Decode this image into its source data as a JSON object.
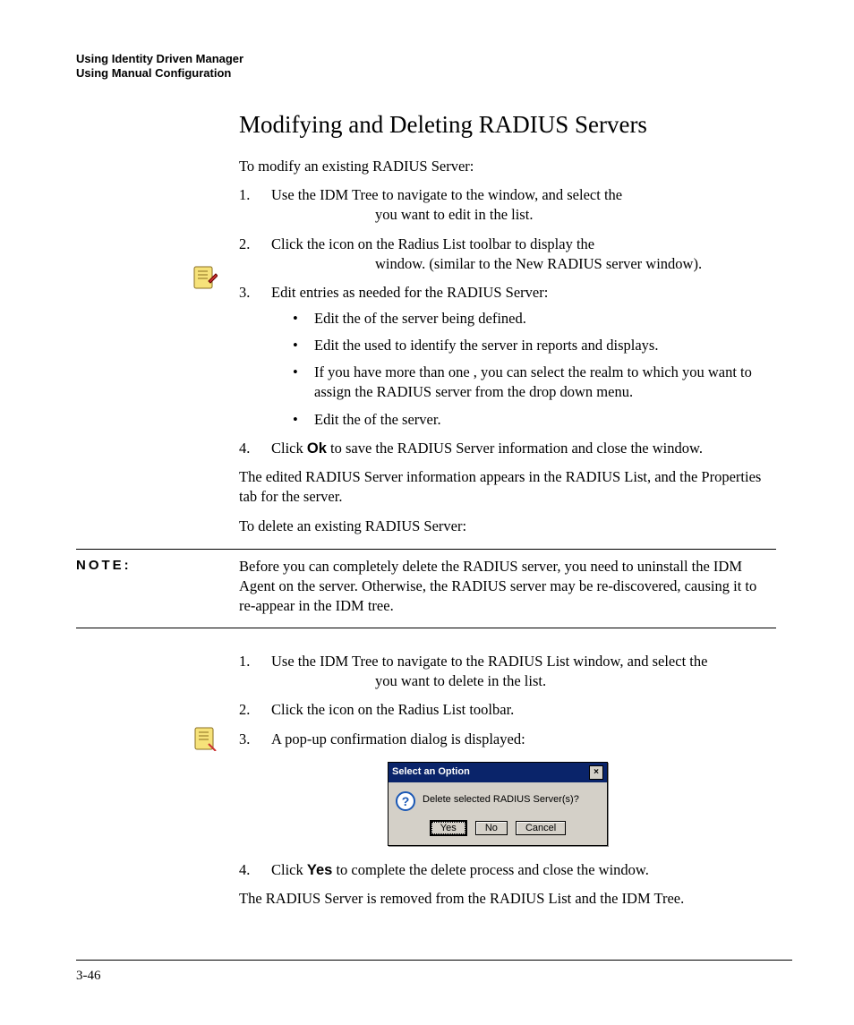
{
  "header": {
    "line1": "Using Identity Driven Manager",
    "line2": "Using Manual Configuration"
  },
  "section_title": "Modifying and Deleting RADIUS Servers",
  "modify_intro": "To modify an existing RADIUS Server:",
  "modify_steps": {
    "s1a": "Use the IDM Tree to navigate to the ",
    "s1b": " window, and select the ",
    "s1c": " you want to edit in the list.",
    "s1_blank1": "",
    "s1_blank2": "",
    "s2a": "Click the ",
    "s2b": " icon on the Radius List toolbar to display the ",
    "s2c": " window. (similar to the New RADIUS server window).",
    "s3": "Edit entries as needed for the RADIUS Server:",
    "b1a": "Edit the ",
    "b1b": " of the server being defined.",
    "b2a": "Edit the ",
    "b2b": " used to identify the server in reports and displays.",
    "b3a": "If you have more than one ",
    "b3b": ", you can select the realm to which you want to assign the RADIUS server from the drop down menu.",
    "b4a": "Edit the ",
    "b4b": " of the server.",
    "s4a": "Click ",
    "s4_ok": "Ok",
    "s4b": " to save the RADIUS Server information and close the window."
  },
  "modify_after": "The edited RADIUS Server information appears in the RADIUS List, and the Properties tab for the server.",
  "delete_intro": "To delete an existing RADIUS Server:",
  "note": {
    "label": "NOTE:",
    "text": "Before you can completely delete the RADIUS server, you need to uninstall the IDM Agent on the server. Otherwise, the RADIUS server may be re-discovered, causing it to re-appear in the IDM tree."
  },
  "delete_steps": {
    "s1a": "Use the IDM Tree to navigate to the RADIUS List window, and select the ",
    "s1b": " you want to delete in the list.",
    "s2a": "Click the ",
    "s2b": " icon on the Radius List toolbar.",
    "s3": "A pop-up confirmation dialog is displayed:",
    "s4a": "Click ",
    "s4_yes": "Yes",
    "s4b": " to complete the delete process and close the window."
  },
  "dialog": {
    "title": "Select an Option",
    "message": "Delete selected RADIUS Server(s)?",
    "yes": "Yes",
    "no": "No",
    "cancel": "Cancel"
  },
  "delete_after": "The RADIUS Server is removed from the RADIUS List and the IDM Tree.",
  "folio": "3-46"
}
